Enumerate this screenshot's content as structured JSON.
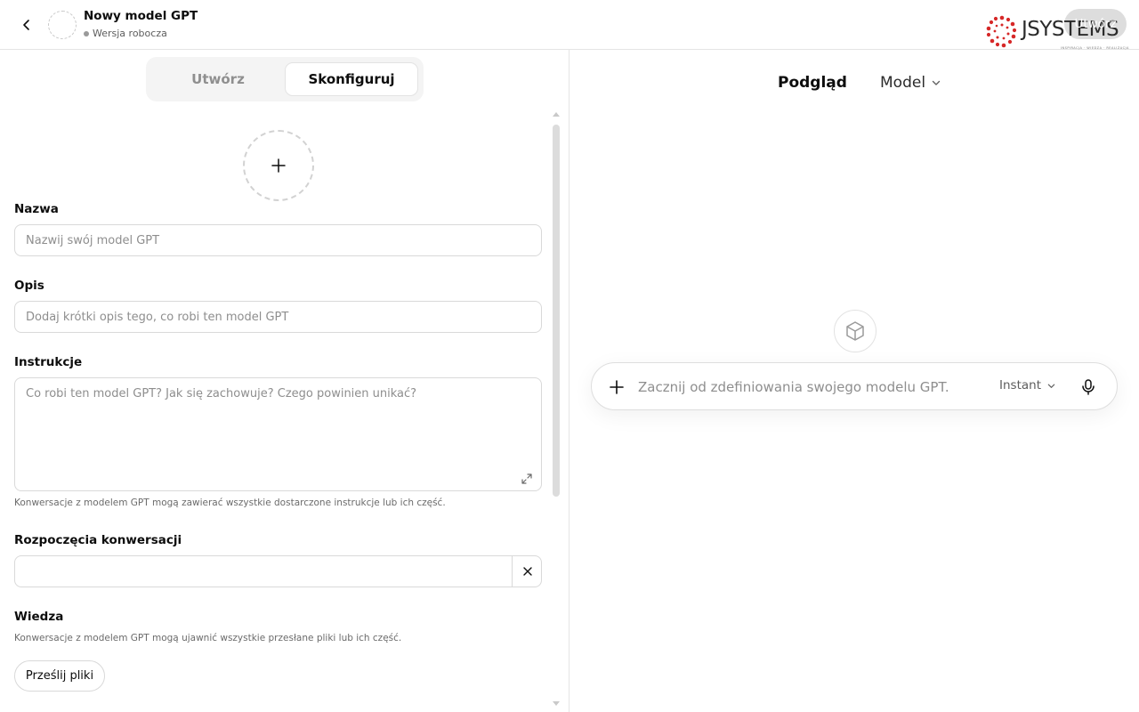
{
  "header": {
    "title": "Nowy model GPT",
    "status": "Wersja robocza",
    "create_label": "Utwórz",
    "logo": {
      "brand": "JSYSTEMS",
      "tagline": "INSPIRACJA · WIEDZA · REALIZACJA",
      "dot_color": "#d62828"
    }
  },
  "tabs": [
    {
      "label": "Utwórz",
      "active": false
    },
    {
      "label": "Skonfiguruj",
      "active": true
    }
  ],
  "form": {
    "name": {
      "label": "Nazwa",
      "placeholder": "Nazwij swój model GPT",
      "value": ""
    },
    "description": {
      "label": "Opis",
      "placeholder": "Dodaj krótki opis tego, co robi ten model GPT",
      "value": ""
    },
    "instructions": {
      "label": "Instrukcje",
      "placeholder": "Co robi ten model GPT? Jak się zachowuje? Czego powinien unikać?",
      "value": "",
      "hint": "Konwersacje z modelem GPT mogą zawierać wszystkie dostarczone instrukcje lub ich część."
    },
    "starters": {
      "label": "Rozpoczęcia konwersacji",
      "value": ""
    },
    "knowledge": {
      "label": "Wiedza",
      "hint": "Konwersacje z modelem GPT mogą ujawnić wszystkie przesłane pliki lub ich część.",
      "upload_label": "Prześlij pliki"
    }
  },
  "preview": {
    "title": "Podgląd",
    "model_label": "Model",
    "composer_placeholder": "Zacznij od zdefiniowania swojego modelu GPT.",
    "mode_label": "Instant"
  },
  "icons": {
    "back": "chevron-left-icon",
    "add_avatar": "plus-icon",
    "expand": "expand-icon",
    "clear": "close-icon",
    "gpt": "cube-icon",
    "attach": "plus-icon",
    "mic": "microphone-icon"
  }
}
